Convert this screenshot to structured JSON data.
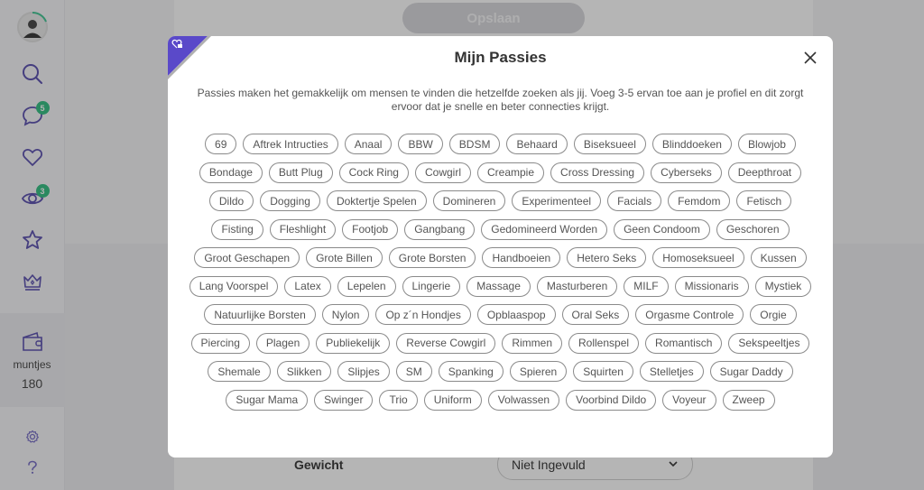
{
  "sidebar": {
    "items": [
      {
        "name": "search",
        "badge": null
      },
      {
        "name": "messages",
        "badge": "5"
      },
      {
        "name": "favorites",
        "badge": null
      },
      {
        "name": "visitors",
        "badge": "3"
      },
      {
        "name": "starred",
        "badge": null
      },
      {
        "name": "premium",
        "badge": null
      }
    ],
    "wallet": {
      "label": "muntjes",
      "value": "180"
    }
  },
  "background": {
    "save_label": "Opslaan",
    "weight_label": "Gewicht",
    "weight_value": "Niet Ingevuld"
  },
  "modal": {
    "title": "Mijn Passies",
    "description": "Passies maken het gemakkelijk om mensen te vinden die hetzelfde zoeken als jij. Voeg 3-5 ervan toe aan je profiel en dit zorgt ervoor dat je snelle en beter connecties krijgt.",
    "tags": [
      "69",
      "Aftrek Intructies",
      "Anaal",
      "BBW",
      "BDSM",
      "Behaard",
      "Biseksueel",
      "Blinddoeken",
      "Blowjob",
      "Bondage",
      "Butt Plug",
      "Cock Ring",
      "Cowgirl",
      "Creampie",
      "Cross Dressing",
      "Cyberseks",
      "Deepthroat",
      "Dildo",
      "Dogging",
      "Doktertje Spelen",
      "Domineren",
      "Experimenteel",
      "Facials",
      "Femdom",
      "Fetisch",
      "Fisting",
      "Fleshlight",
      "Footjob",
      "Gangbang",
      "Gedomineerd Worden",
      "Geen Condoom",
      "Geschoren",
      "Groot Geschapen",
      "Grote Billen",
      "Grote Borsten",
      "Handboeien",
      "Hetero Seks",
      "Homoseksueel",
      "Kussen",
      "Lang Voorspel",
      "Latex",
      "Lepelen",
      "Lingerie",
      "Massage",
      "Masturberen",
      "MILF",
      "Missionaris",
      "Mystiek",
      "Natuurlijke Borsten",
      "Nylon",
      "Op z´n Hondjes",
      "Opblaaspop",
      "Oral Seks",
      "Orgasme Controle",
      "Orgie",
      "Piercing",
      "Plagen",
      "Publiekelijk",
      "Reverse Cowgirl",
      "Rimmen",
      "Rollenspel",
      "Romantisch",
      "Sekspeeltjes",
      "Shemale",
      "Slikken",
      "Slipjes",
      "SM",
      "Spanking",
      "Spieren",
      "Squirten",
      "Stelletjes",
      "Sugar Daddy",
      "Sugar Mama",
      "Swinger",
      "Trio",
      "Uniform",
      "Volwassen",
      "Voorbind Dildo",
      "Voyeur",
      "Zweep"
    ]
  },
  "colors": {
    "accent": "#5a49c9",
    "badge": "#1fb877",
    "progress": "#2ec08a"
  }
}
